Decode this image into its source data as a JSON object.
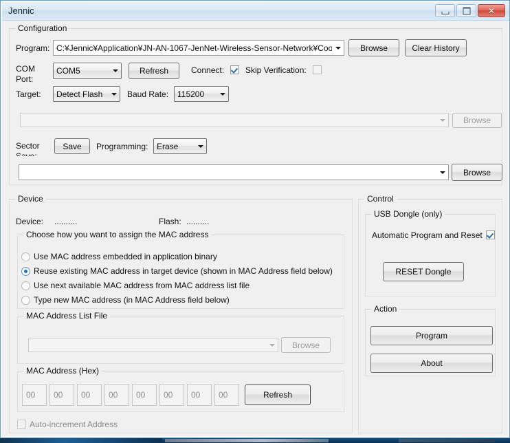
{
  "window": {
    "title": "Jennic",
    "controls": {
      "minimize": "–",
      "maximize": "□",
      "close": "✕"
    }
  },
  "configuration": {
    "legend": "Configuration",
    "program_label": "Program:",
    "program_value": "C:¥Jennic¥Application¥JN-AN-1067-JenNet-Wireless-Sensor-Network¥Coor",
    "browse_label": "Browse",
    "clear_history_label": "Clear History",
    "com_port_label_line1": "COM",
    "com_port_label_line2": "Port:",
    "com_port_value": "COM5",
    "refresh_label": "Refresh",
    "connect_label": "Connect:",
    "connect_checked": true,
    "skip_verification_label": "Skip Verification:",
    "skip_verification_checked": false,
    "target_label": "Target:",
    "target_value": "Detect Flash",
    "baud_rate_label": "Baud Rate:",
    "baud_rate_value": "115200",
    "secondary_file_value": "",
    "secondary_browse_label": "Browse",
    "sector_label_line1": "Sector",
    "sector_label_line2": "Save:",
    "save_label": "Save",
    "programming_label": "Programming:",
    "programming_value": "Erase",
    "main_file_value": "",
    "main_browse_label": "Browse"
  },
  "device": {
    "legend": "Device",
    "device_label": "Device:",
    "device_value": "..........",
    "flash_label": "Flash:",
    "flash_value": "..........",
    "mac_choice_legend": "Choose how you want to assign the MAC address",
    "mac_options": [
      {
        "label": "Use MAC address embedded in application binary",
        "selected": false
      },
      {
        "label": "Reuse existing MAC address in target device (shown in MAC Address field below)",
        "selected": true
      },
      {
        "label": "Use next available MAC address from MAC address list file",
        "selected": false
      },
      {
        "label": "Type new MAC address (in MAC Address field below)",
        "selected": false
      }
    ],
    "mac_list_file_legend": "MAC Address List File",
    "mac_list_file_value": "",
    "mac_list_browse_label": "Browse",
    "mac_hex_legend": "MAC Address (Hex)",
    "mac_hex_values": [
      "00",
      "00",
      "00",
      "00",
      "00",
      "00",
      "00",
      "00"
    ],
    "mac_refresh_label": "Refresh",
    "auto_increment_label": "Auto-increment Address",
    "auto_increment_checked": false
  },
  "control": {
    "legend": "Control",
    "usb_dongle_legend": "USB Dongle (only)",
    "automatic_program_reset_label": "Automatic Program and Reset",
    "automatic_program_reset_checked": true,
    "reset_dongle_label": "RESET Dongle",
    "action_legend": "Action",
    "program_label": "Program",
    "about_label": "About"
  },
  "colors": {
    "window_bg": "#f0f0f0",
    "title_accent": "#cddff0",
    "close_button": "#cd4a39",
    "radio_accent": "#2272b8",
    "check_accent": "#2e6ea8"
  }
}
